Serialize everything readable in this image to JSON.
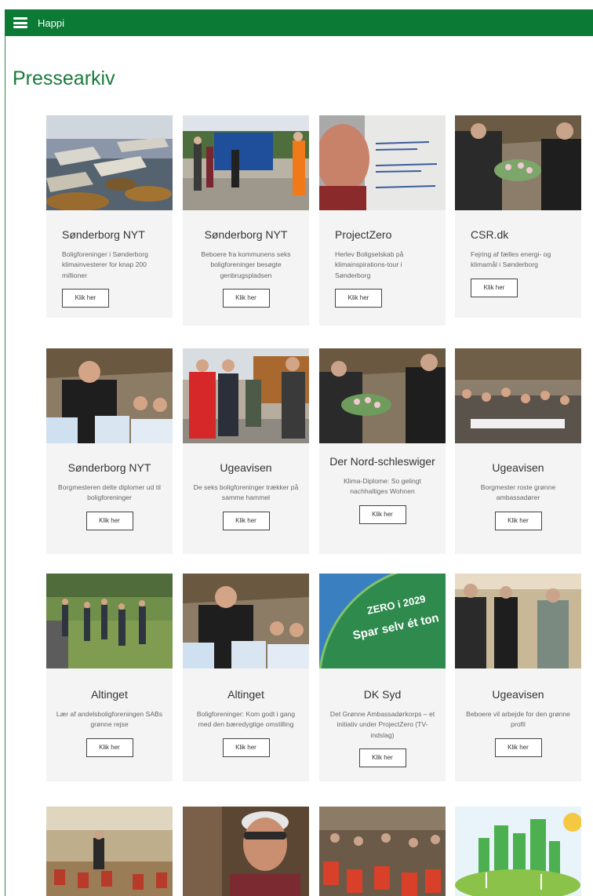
{
  "app": {
    "title": "Happi"
  },
  "page": {
    "title": "Pressearkiv"
  },
  "button_label": "Klik her",
  "colors": {
    "header": "#0a7a35",
    "title": "#1a7a3c",
    "card_bg": "#f4f4f4"
  },
  "articles": [
    {
      "source": "Sønderborg NYT",
      "description": "Boligforeninger i Sønderborg klimainvesterer for knap 200 millioner"
    },
    {
      "source": "Sønderborg NYT",
      "description": "Beboere fra kommunens seks boligforeninger besøgte genbrugspladsen"
    },
    {
      "source": "ProjectZero",
      "description": "Herlev Boligselskab på klimainspirations-tour i Sønderborg"
    },
    {
      "source": "CSR.dk",
      "description": "Fejring af fælles energi- og klimamål i Sønderborg"
    },
    {
      "source": "Sønderborg NYT",
      "description": "Borgmesteren delte diplomer ud til boligforeninger"
    },
    {
      "source": "Ugeavisen",
      "description": "De seks boligforeninger trækker på samme hammel"
    },
    {
      "source": "Der Nord-schleswiger",
      "description": "Klima-Diplome: So gelingt nachhaltiges Wohnen"
    },
    {
      "source": "Ugeavisen",
      "description": "Borgmester roste grønne ambassadører"
    },
    {
      "source": "Altinget",
      "description": "Lær af andelsboligforeningen SABs grønne rejse"
    },
    {
      "source": "Altinget",
      "description": "Boligforeninger: Kom godt i gang med den bæredygtige omstilling"
    },
    {
      "source": "DK Syd",
      "description": "Det Grønne Ambassadørkorps – et initiativ under ProjectZero (TV-indslag)"
    },
    {
      "source": "Ugeavisen",
      "description": "Beboere vil arbejde for den grønne profil"
    }
  ],
  "image_texts": {
    "zero_globe": "ZERO i 2029\nSpar selv ét ton"
  }
}
